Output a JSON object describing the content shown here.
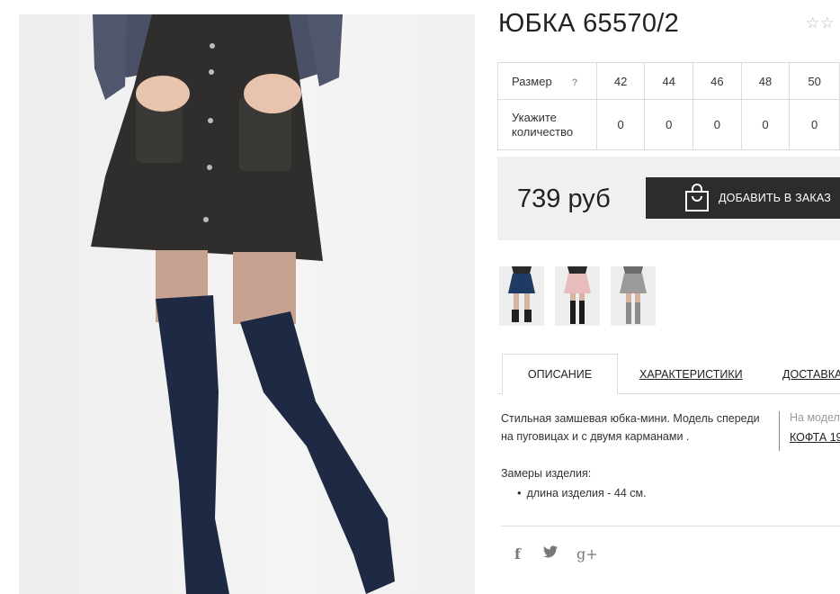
{
  "product": {
    "title": "ЮБКА 65570/2",
    "rating_stars": "☆☆"
  },
  "size_table": {
    "size_label": "Размер",
    "help_label": "?",
    "qty_label": "Укажите количество",
    "sizes": [
      "42",
      "44",
      "46",
      "48",
      "50"
    ],
    "quantities": [
      "0",
      "0",
      "0",
      "0",
      "0"
    ]
  },
  "purchase": {
    "price": "739 руб",
    "add_to_cart_label": "ДОБАВИТЬ В ЗАКАЗ",
    "button_color": "#2c2c2c"
  },
  "tabs": [
    {
      "label": "ОПИСАНИЕ",
      "active": true
    },
    {
      "label": "ХАРАКТЕРИСТИКИ",
      "active": false
    },
    {
      "label": "ДОСТАВКА",
      "active": false
    }
  ],
  "description": {
    "text": "Стильная замшевая юбка-мини. Модель спереди на пуговицах и с двумя карманами .",
    "model_label": "На модел",
    "model_link": "КОФТА 19",
    "measures_title": "Замеры изделия:",
    "measures": [
      "длина изделия - 44 см."
    ]
  },
  "thumbnails": [
    {
      "name": "navy-skirt",
      "color": "#1f3a63"
    },
    {
      "name": "pink-skirt",
      "color": "#e9bcbc"
    },
    {
      "name": "grey-skirt",
      "color": "#9a9a9a"
    }
  ],
  "social": {
    "facebook": "f",
    "twitter": "🐦",
    "google_plus": "g+"
  },
  "icons": [
    "star-icon",
    "help-icon",
    "shopping-bag-icon",
    "facebook-icon",
    "twitter-icon",
    "google-plus-icon"
  ]
}
